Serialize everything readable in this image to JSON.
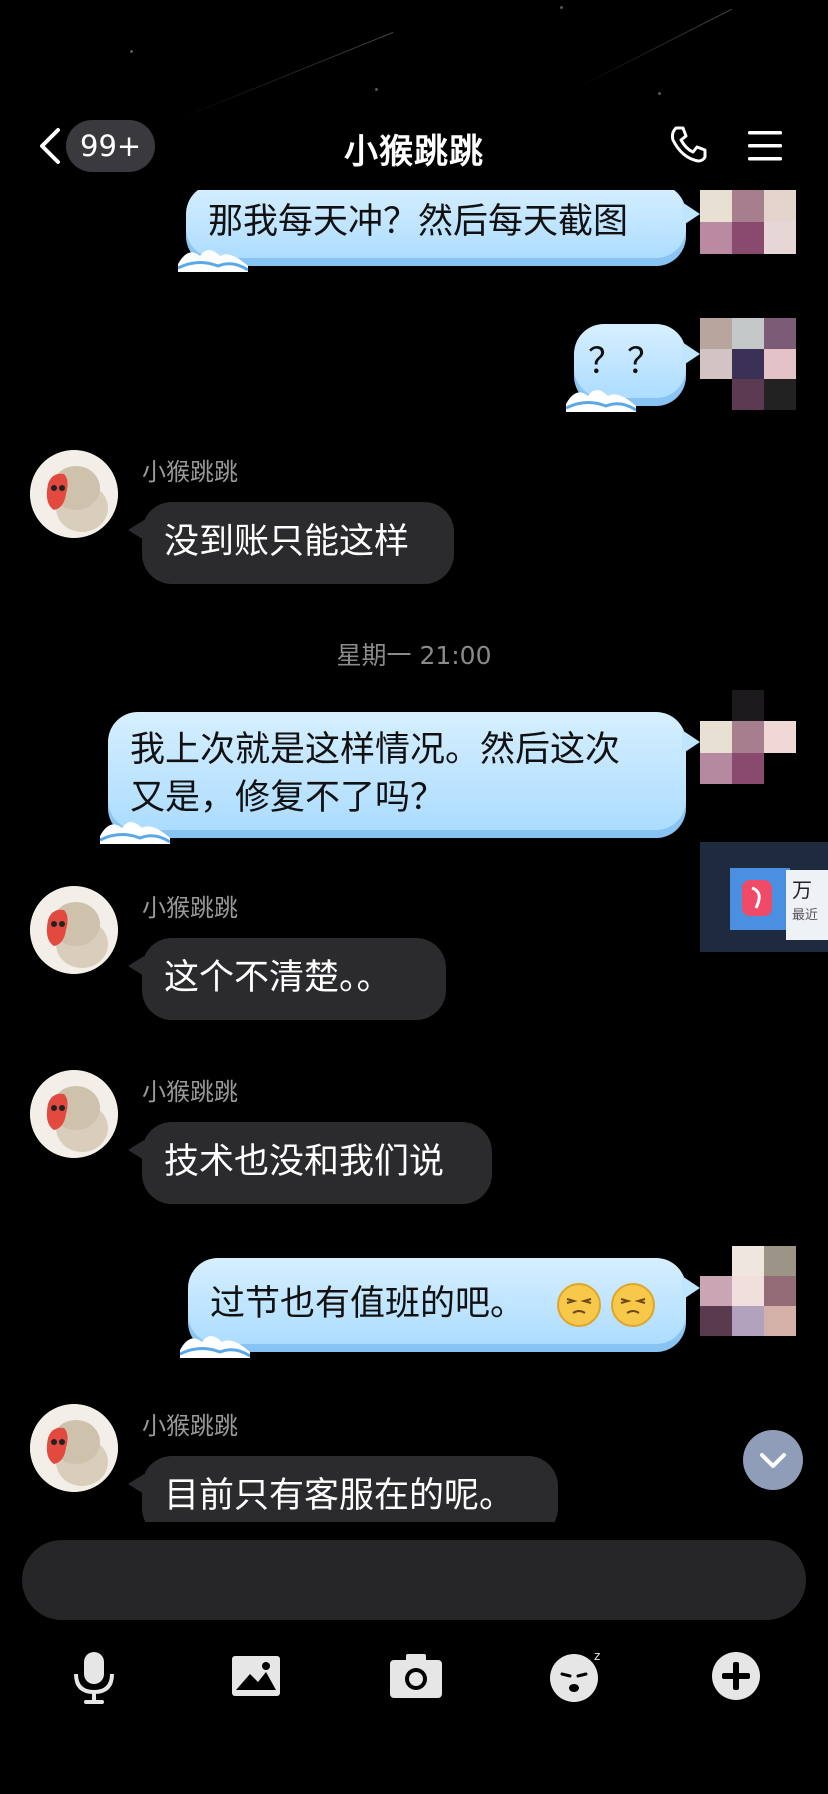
{
  "header": {
    "back_icon": "chevron-left-icon",
    "unread_badge": "99+",
    "title": "小猴跳跳",
    "call_icon": "phone-icon",
    "menu_icon": "menu-icon"
  },
  "messages": [
    {
      "side": "out",
      "text": "那我每天冲？然后每天截图"
    },
    {
      "side": "out",
      "text": "？？"
    },
    {
      "side": "in",
      "sender": "小猴跳跳",
      "text": "没到账只能这样"
    },
    {
      "timestamp": "星期一 21:00"
    },
    {
      "side": "out",
      "text_line1": "我上次就是这样情况。然后这次",
      "text_line2": "又是，修复不了吗？"
    },
    {
      "side": "in",
      "sender": "小猴跳跳",
      "text": "这个不清楚。。"
    },
    {
      "side": "in",
      "sender": "小猴跳跳",
      "text": "技术也没和我们说"
    },
    {
      "side": "out",
      "text": "过节也有值班的吧。",
      "emoji": [
        "smug-face-icon",
        "smug-face-icon"
      ]
    },
    {
      "side": "in",
      "sender": "小猴跳跳",
      "text": "目前只有客服在的呢。"
    }
  ],
  "floating_card": {
    "title": "万",
    "subtitle": "最近"
  },
  "colors": {
    "outgoing_bubble": "#bfe5ff",
    "incoming_bubble": "#2b2b2e",
    "background": "#000000"
  },
  "toolbar": [
    "microphone-icon",
    "image-icon",
    "camera-icon",
    "sticker-icon",
    "plus-icon"
  ]
}
